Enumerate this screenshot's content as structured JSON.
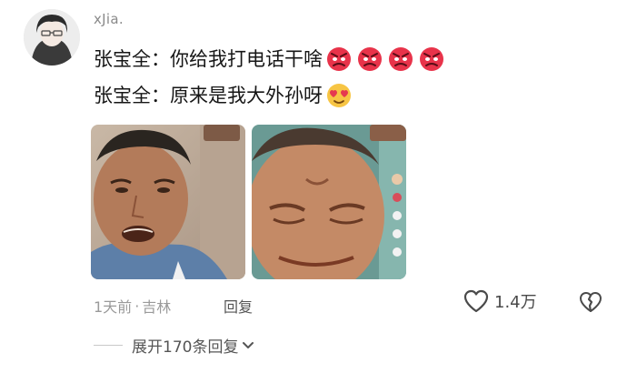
{
  "comment": {
    "username": "xJia.",
    "lines": [
      {
        "text": "张宝全：你给我打电话干啥",
        "emoji": [
          "angry-face-emoji",
          "angry-face-emoji",
          "angry-face-emoji",
          "angry-face-emoji"
        ]
      },
      {
        "text": "张宝全：原来是我大外孙呀",
        "emoji": [
          "heart-eyes-emoji"
        ]
      }
    ],
    "meta": {
      "time": "1天前",
      "separator": "·",
      "location": "吉林",
      "reply_label": "回复"
    },
    "likes": "1.4万",
    "expand_label": "展开170条回复"
  },
  "colors": {
    "angry_emoji": "#e8334a",
    "heart_emoji": "#f7c544",
    "muted_text": "#9a9a9a"
  }
}
